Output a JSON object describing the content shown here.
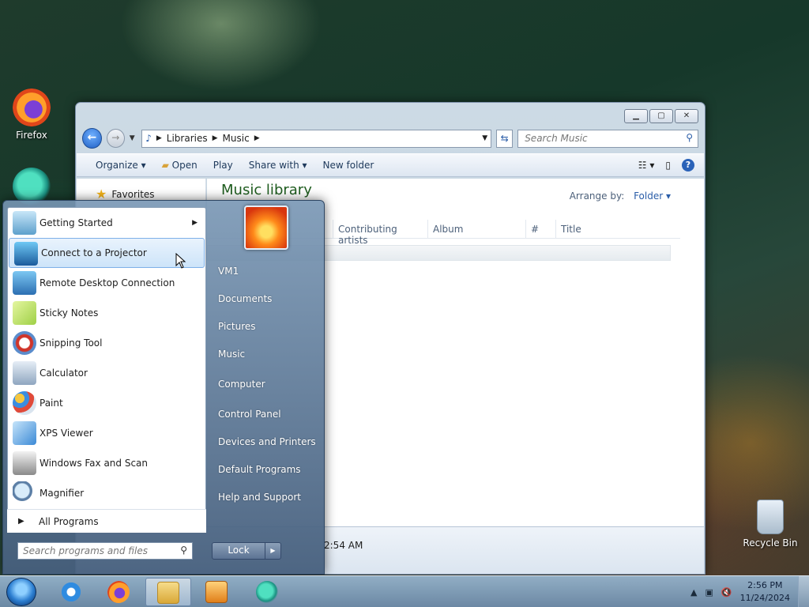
{
  "desktop": {
    "icons": [
      {
        "label": "Firefox"
      },
      {
        "label": "Recycle Bin"
      }
    ]
  },
  "explorer": {
    "breadcrumb": [
      "Libraries",
      "Music"
    ],
    "search_placeholder": "Search Music",
    "toolbar": {
      "organize": "Organize",
      "open": "Open",
      "play": "Play",
      "share_with": "Share with",
      "new_folder": "New folder"
    },
    "nav": {
      "favorites": "Favorites"
    },
    "library_title": "Music library",
    "arrange_label": "Arrange by:",
    "arrange_value": "Folder",
    "columns": [
      "Contributing artists",
      "Album",
      "#",
      "Title"
    ],
    "details_text": "2:54 AM"
  },
  "start_menu": {
    "programs": [
      {
        "label": "Getting Started",
        "has_submenu": true
      },
      {
        "label": "Connect to a Projector",
        "selected": true
      },
      {
        "label": "Remote Desktop Connection"
      },
      {
        "label": "Sticky Notes"
      },
      {
        "label": "Snipping Tool"
      },
      {
        "label": "Calculator"
      },
      {
        "label": "Paint"
      },
      {
        "label": "XPS Viewer"
      },
      {
        "label": "Windows Fax and Scan"
      },
      {
        "label": "Magnifier"
      }
    ],
    "all_programs": "All Programs",
    "search_placeholder": "Search programs and files",
    "right_items": [
      "VM1",
      "Documents",
      "Pictures",
      "Music",
      "Computer",
      "Control Panel",
      "Devices and Printers",
      "Default Programs",
      "Help and Support"
    ],
    "lock_label": "Lock"
  },
  "taskbar": {
    "time": "2:56 PM",
    "date": "11/24/2024"
  },
  "colors": {
    "library_title": "#1e5c1e",
    "link_blue": "#2a5da8"
  }
}
